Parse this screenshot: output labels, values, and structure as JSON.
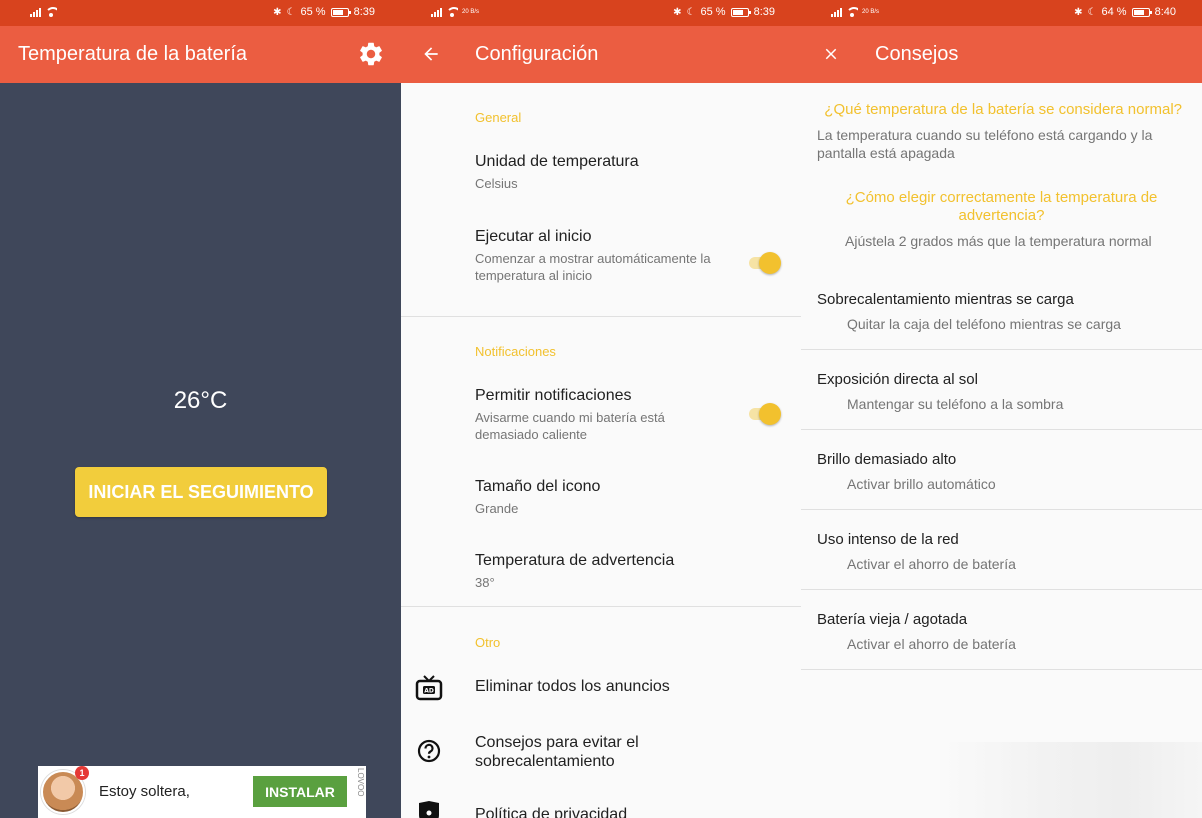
{
  "panels": [
    {
      "status": {
        "battery": "65 %",
        "time": "8:39"
      },
      "appbar": {
        "title": "Temperatura de la batería",
        "action_icon": "gear-icon"
      },
      "temperature": "26°C",
      "start_button": "INICIAR EL SEGUIMIENTO",
      "ad": {
        "badge": "1",
        "text": "Estoy soltera,",
        "install": "INSTALAR",
        "brand": "LOVOO"
      }
    },
    {
      "status": {
        "network": "20 B/s",
        "battery": "65 %",
        "time": "8:39"
      },
      "appbar": {
        "title": "Configuración",
        "nav_icon": "arrow-back-icon"
      },
      "sections": {
        "general": "General",
        "notifications": "Notificaciones",
        "other": "Otro"
      },
      "items": {
        "unit": {
          "title": "Unidad de temperatura",
          "subtitle": "Celsius"
        },
        "autostart": {
          "title": "Ejecutar al inicio",
          "subtitle": "Comenzar a mostrar automáticamente la temperatura al inicio",
          "enabled": true
        },
        "notify": {
          "title": "Permitir notificaciones",
          "subtitle": "Avisarme cuando mi batería está demasiado caliente",
          "enabled": true
        },
        "icon_size": {
          "title": "Tamaño del icono",
          "subtitle": "Grande"
        },
        "warning_temp": {
          "title": "Temperatura de advertencia",
          "subtitle": "38°"
        },
        "remove_ads": {
          "title": "Eliminar todos los anuncios",
          "icon": "tv-ad-icon"
        },
        "tips": {
          "title": "Consejos para evitar el sobrecalentamiento",
          "icon": "help-circle-icon"
        },
        "privacy": {
          "title": "Política de privacidad",
          "icon": "lock-icon"
        }
      }
    },
    {
      "status": {
        "network": "20 B/s",
        "battery": "64 %",
        "time": "8:40"
      },
      "appbar": {
        "title": "Consejos",
        "nav_icon": "close-icon"
      },
      "faq": [
        {
          "q": "¿Qué temperatura de la batería se considera normal?",
          "a": "La temperatura cuando su teléfono está cargando y la pantalla está apagada"
        },
        {
          "q": "¿Cómo elegir correctamente la temperatura de advertencia?",
          "a": "Ajústela 2 grados más que la temperatura normal"
        }
      ],
      "tips": [
        {
          "title": "Sobrecalentamiento mientras se carga",
          "advice": "Quitar la caja del teléfono mientras se carga"
        },
        {
          "title": "Exposición directa al sol",
          "advice": "Mantengar su teléfono a la sombra"
        },
        {
          "title": "Brillo demasiado alto",
          "advice": "Activar brillo automático"
        },
        {
          "title": "Uso intenso de la red",
          "advice": "Activar el ahorro de batería"
        },
        {
          "title": "Batería vieja / agotada",
          "advice": "Activar el ahorro de batería"
        }
      ]
    }
  ],
  "colors": {
    "statusbar": "#d8431e",
    "appbar": "#eb5d41",
    "main_bg": "#3f475a",
    "accent": "#f2c12e",
    "button": "#f2cd3c",
    "install": "#5aa03f"
  }
}
